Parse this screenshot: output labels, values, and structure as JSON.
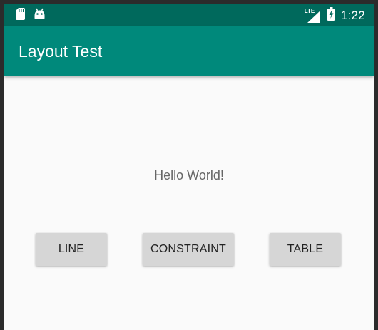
{
  "status_bar": {
    "icons_left": [
      "sd-card-icon",
      "android-icon"
    ],
    "network_label": "LTE",
    "time": "1:22"
  },
  "app_bar": {
    "title": "Layout Test"
  },
  "main": {
    "message": "Hello World!",
    "buttons": [
      {
        "label": "LINE"
      },
      {
        "label": "CONSTRAINT"
      },
      {
        "label": "TABLE"
      }
    ]
  },
  "colors": {
    "status_bar": "#00695c",
    "app_bar": "#00897b",
    "background": "#fafafa",
    "button": "#d6d6d6"
  }
}
